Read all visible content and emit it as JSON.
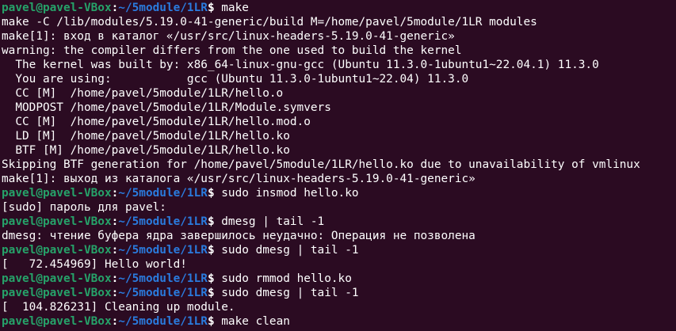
{
  "colors": {
    "background": "#2b0b22",
    "user_host": "#26a269",
    "path": "#2a7bde",
    "text": "#ffffff"
  },
  "prompt": {
    "user_host": "pavel@pavel-VBox",
    "colon": ":",
    "path": "~/5module/1LR",
    "symbol": "$ "
  },
  "lines": [
    {
      "type": "prompt",
      "cmd": "make"
    },
    {
      "type": "out",
      "text": "make -C /lib/modules/5.19.0-41-generic/build M=/home/pavel/5module/1LR modules"
    },
    {
      "type": "out",
      "text": "make[1]: вход в каталог «/usr/src/linux-headers-5.19.0-41-generic»"
    },
    {
      "type": "out",
      "text": "warning: the compiler differs from the one used to build the kernel"
    },
    {
      "type": "out",
      "text": "  The kernel was built by: x86_64-linux-gnu-gcc (Ubuntu 11.3.0-1ubuntu1~22.04.1) 11.3.0"
    },
    {
      "type": "out",
      "text": "  You are using:           gcc (Ubuntu 11.3.0-1ubuntu1~22.04) 11.3.0"
    },
    {
      "type": "out",
      "text": "  CC [M]  /home/pavel/5module/1LR/hello.o"
    },
    {
      "type": "out",
      "text": "  MODPOST /home/pavel/5module/1LR/Module.symvers"
    },
    {
      "type": "out",
      "text": "  CC [M]  /home/pavel/5module/1LR/hello.mod.o"
    },
    {
      "type": "out",
      "text": "  LD [M]  /home/pavel/5module/1LR/hello.ko"
    },
    {
      "type": "out",
      "text": "  BTF [M] /home/pavel/5module/1LR/hello.ko"
    },
    {
      "type": "out",
      "text": "Skipping BTF generation for /home/pavel/5module/1LR/hello.ko due to unavailability of vmlinux"
    },
    {
      "type": "out",
      "text": "make[1]: выход из каталога «/usr/src/linux-headers-5.19.0-41-generic»"
    },
    {
      "type": "prompt",
      "cmd": "sudo insmod hello.ko"
    },
    {
      "type": "out",
      "text": "[sudo] пароль для pavel:"
    },
    {
      "type": "prompt",
      "cmd": "dmesg | tail -1"
    },
    {
      "type": "out",
      "text": "dmesg: чтение буфера ядра завершилось неудачно: Операция не позволена"
    },
    {
      "type": "prompt",
      "cmd": "sudo dmesg | tail -1"
    },
    {
      "type": "out",
      "text": "[   72.454969] Hello world!"
    },
    {
      "type": "prompt",
      "cmd": "sudo rmmod hello.ko"
    },
    {
      "type": "prompt",
      "cmd": "sudo dmesg | tail -1"
    },
    {
      "type": "out",
      "text": "[  104.826231] Cleaning up module."
    },
    {
      "type": "prompt",
      "cmd": "make clean"
    }
  ]
}
